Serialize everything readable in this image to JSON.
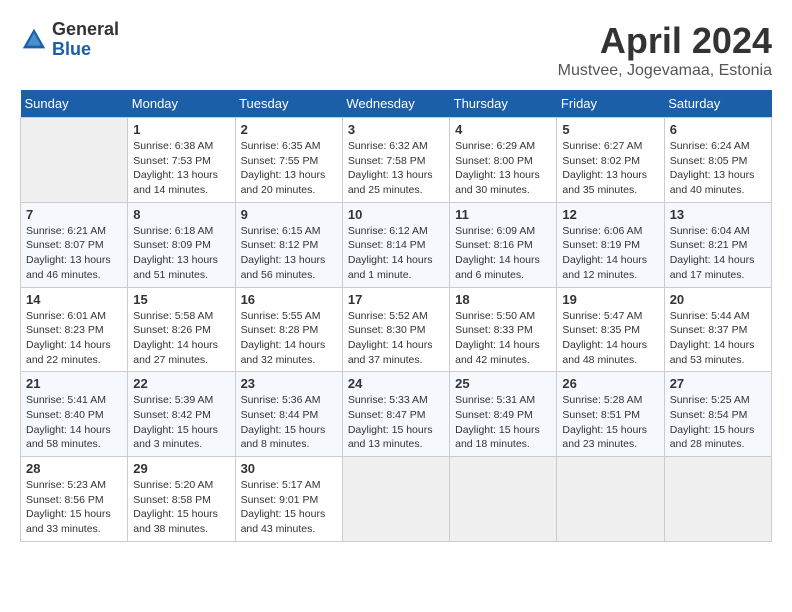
{
  "header": {
    "logo_general": "General",
    "logo_blue": "Blue",
    "month_title": "April 2024",
    "location": "Mustvee, Jogevamaa, Estonia"
  },
  "weekdays": [
    "Sunday",
    "Monday",
    "Tuesday",
    "Wednesday",
    "Thursday",
    "Friday",
    "Saturday"
  ],
  "weeks": [
    [
      {
        "day": "",
        "empty": true
      },
      {
        "day": "1",
        "sunrise": "Sunrise: 6:38 AM",
        "sunset": "Sunset: 7:53 PM",
        "daylight": "Daylight: 13 hours and 14 minutes."
      },
      {
        "day": "2",
        "sunrise": "Sunrise: 6:35 AM",
        "sunset": "Sunset: 7:55 PM",
        "daylight": "Daylight: 13 hours and 20 minutes."
      },
      {
        "day": "3",
        "sunrise": "Sunrise: 6:32 AM",
        "sunset": "Sunset: 7:58 PM",
        "daylight": "Daylight: 13 hours and 25 minutes."
      },
      {
        "day": "4",
        "sunrise": "Sunrise: 6:29 AM",
        "sunset": "Sunset: 8:00 PM",
        "daylight": "Daylight: 13 hours and 30 minutes."
      },
      {
        "day": "5",
        "sunrise": "Sunrise: 6:27 AM",
        "sunset": "Sunset: 8:02 PM",
        "daylight": "Daylight: 13 hours and 35 minutes."
      },
      {
        "day": "6",
        "sunrise": "Sunrise: 6:24 AM",
        "sunset": "Sunset: 8:05 PM",
        "daylight": "Daylight: 13 hours and 40 minutes."
      }
    ],
    [
      {
        "day": "7",
        "sunrise": "Sunrise: 6:21 AM",
        "sunset": "Sunset: 8:07 PM",
        "daylight": "Daylight: 13 hours and 46 minutes."
      },
      {
        "day": "8",
        "sunrise": "Sunrise: 6:18 AM",
        "sunset": "Sunset: 8:09 PM",
        "daylight": "Daylight: 13 hours and 51 minutes."
      },
      {
        "day": "9",
        "sunrise": "Sunrise: 6:15 AM",
        "sunset": "Sunset: 8:12 PM",
        "daylight": "Daylight: 13 hours and 56 minutes."
      },
      {
        "day": "10",
        "sunrise": "Sunrise: 6:12 AM",
        "sunset": "Sunset: 8:14 PM",
        "daylight": "Daylight: 14 hours and 1 minute."
      },
      {
        "day": "11",
        "sunrise": "Sunrise: 6:09 AM",
        "sunset": "Sunset: 8:16 PM",
        "daylight": "Daylight: 14 hours and 6 minutes."
      },
      {
        "day": "12",
        "sunrise": "Sunrise: 6:06 AM",
        "sunset": "Sunset: 8:19 PM",
        "daylight": "Daylight: 14 hours and 12 minutes."
      },
      {
        "day": "13",
        "sunrise": "Sunrise: 6:04 AM",
        "sunset": "Sunset: 8:21 PM",
        "daylight": "Daylight: 14 hours and 17 minutes."
      }
    ],
    [
      {
        "day": "14",
        "sunrise": "Sunrise: 6:01 AM",
        "sunset": "Sunset: 8:23 PM",
        "daylight": "Daylight: 14 hours and 22 minutes."
      },
      {
        "day": "15",
        "sunrise": "Sunrise: 5:58 AM",
        "sunset": "Sunset: 8:26 PM",
        "daylight": "Daylight: 14 hours and 27 minutes."
      },
      {
        "day": "16",
        "sunrise": "Sunrise: 5:55 AM",
        "sunset": "Sunset: 8:28 PM",
        "daylight": "Daylight: 14 hours and 32 minutes."
      },
      {
        "day": "17",
        "sunrise": "Sunrise: 5:52 AM",
        "sunset": "Sunset: 8:30 PM",
        "daylight": "Daylight: 14 hours and 37 minutes."
      },
      {
        "day": "18",
        "sunrise": "Sunrise: 5:50 AM",
        "sunset": "Sunset: 8:33 PM",
        "daylight": "Daylight: 14 hours and 42 minutes."
      },
      {
        "day": "19",
        "sunrise": "Sunrise: 5:47 AM",
        "sunset": "Sunset: 8:35 PM",
        "daylight": "Daylight: 14 hours and 48 minutes."
      },
      {
        "day": "20",
        "sunrise": "Sunrise: 5:44 AM",
        "sunset": "Sunset: 8:37 PM",
        "daylight": "Daylight: 14 hours and 53 minutes."
      }
    ],
    [
      {
        "day": "21",
        "sunrise": "Sunrise: 5:41 AM",
        "sunset": "Sunset: 8:40 PM",
        "daylight": "Daylight: 14 hours and 58 minutes."
      },
      {
        "day": "22",
        "sunrise": "Sunrise: 5:39 AM",
        "sunset": "Sunset: 8:42 PM",
        "daylight": "Daylight: 15 hours and 3 minutes."
      },
      {
        "day": "23",
        "sunrise": "Sunrise: 5:36 AM",
        "sunset": "Sunset: 8:44 PM",
        "daylight": "Daylight: 15 hours and 8 minutes."
      },
      {
        "day": "24",
        "sunrise": "Sunrise: 5:33 AM",
        "sunset": "Sunset: 8:47 PM",
        "daylight": "Daylight: 15 hours and 13 minutes."
      },
      {
        "day": "25",
        "sunrise": "Sunrise: 5:31 AM",
        "sunset": "Sunset: 8:49 PM",
        "daylight": "Daylight: 15 hours and 18 minutes."
      },
      {
        "day": "26",
        "sunrise": "Sunrise: 5:28 AM",
        "sunset": "Sunset: 8:51 PM",
        "daylight": "Daylight: 15 hours and 23 minutes."
      },
      {
        "day": "27",
        "sunrise": "Sunrise: 5:25 AM",
        "sunset": "Sunset: 8:54 PM",
        "daylight": "Daylight: 15 hours and 28 minutes."
      }
    ],
    [
      {
        "day": "28",
        "sunrise": "Sunrise: 5:23 AM",
        "sunset": "Sunset: 8:56 PM",
        "daylight": "Daylight: 15 hours and 33 minutes."
      },
      {
        "day": "29",
        "sunrise": "Sunrise: 5:20 AM",
        "sunset": "Sunset: 8:58 PM",
        "daylight": "Daylight: 15 hours and 38 minutes."
      },
      {
        "day": "30",
        "sunrise": "Sunrise: 5:17 AM",
        "sunset": "Sunset: 9:01 PM",
        "daylight": "Daylight: 15 hours and 43 minutes."
      },
      {
        "day": "",
        "empty": true
      },
      {
        "day": "",
        "empty": true
      },
      {
        "day": "",
        "empty": true
      },
      {
        "day": "",
        "empty": true
      }
    ]
  ]
}
